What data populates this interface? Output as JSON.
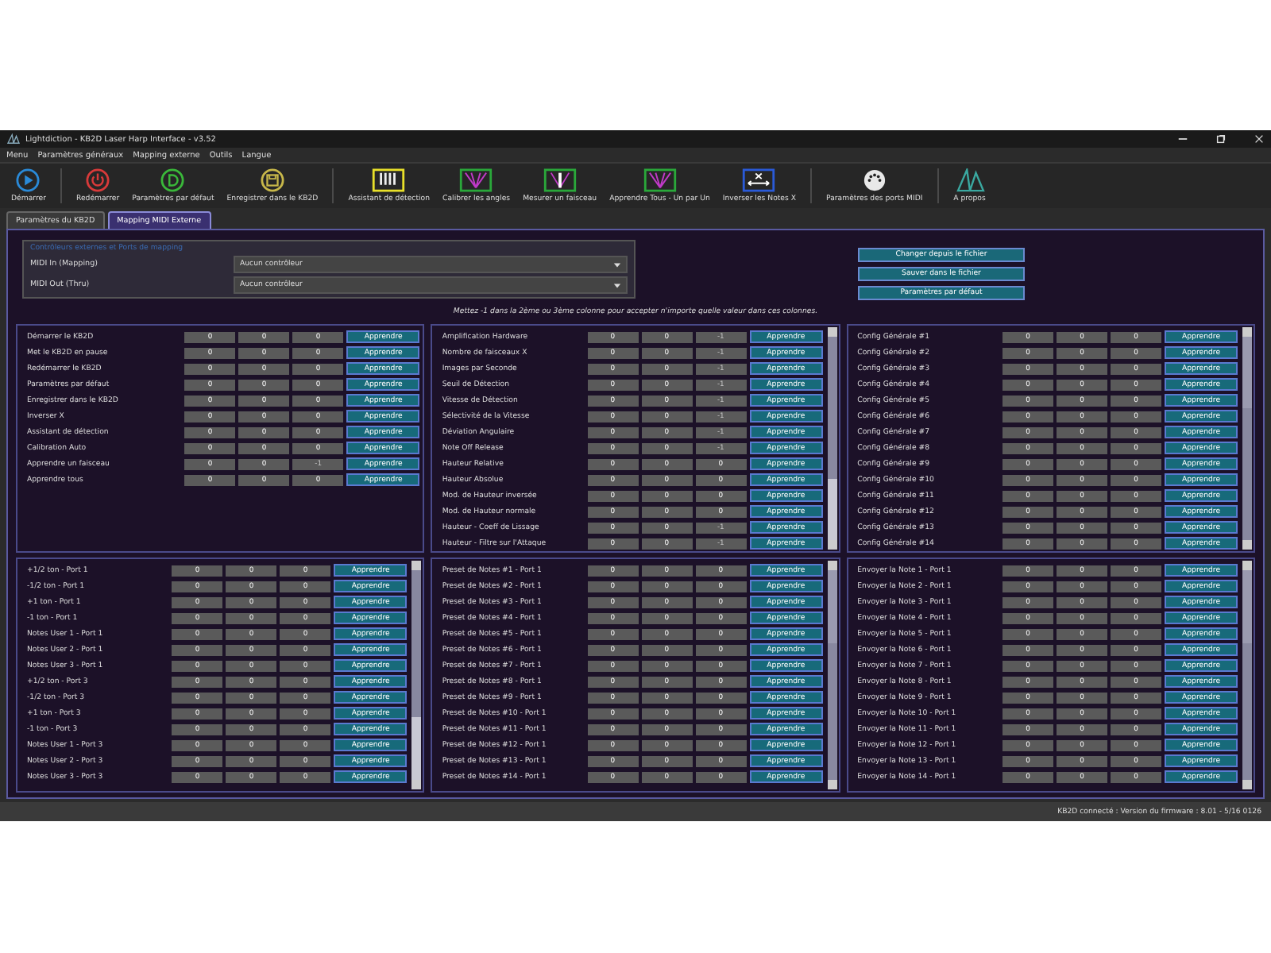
{
  "window": {
    "title": "Lightdiction - KB2D Laser Harp Interface - v3.52"
  },
  "menu": [
    "Menu",
    "Paramètres généraux",
    "Mapping externe",
    "Outils",
    "Langue"
  ],
  "toolbar": [
    {
      "label": "Démarrer",
      "kind": "play"
    },
    {
      "label": "Redémarrer",
      "kind": "power"
    },
    {
      "label": "Paramètres par défaut",
      "kind": "default"
    },
    {
      "label": "Enregistrer dans le KB2D",
      "kind": "save"
    },
    {
      "label": "Assistant de détection",
      "kind": "keys"
    },
    {
      "label": "Calibrer les angles",
      "kind": "fan"
    },
    {
      "label": "Mesurer un faisceau",
      "kind": "measure"
    },
    {
      "label": "Apprendre Tous - Un par Un",
      "kind": "fan"
    },
    {
      "label": "Inverser les Notes X",
      "kind": "swap"
    },
    {
      "label": "Paramètres des ports MIDI",
      "kind": "midi"
    },
    {
      "label": "A propos",
      "kind": "logo"
    }
  ],
  "tabs": [
    {
      "label": "Paramètres du KB2D",
      "selected": false
    },
    {
      "label": "Mapping MIDI Externe",
      "selected": true
    }
  ],
  "controllers": {
    "title": "Contrôleurs externes et Ports de mapping",
    "fields": [
      {
        "label": "MIDI In (Mapping)",
        "value": "Aucun contrôleur"
      },
      {
        "label": "MIDI Out (Thru)",
        "value": "Aucun contrôleur"
      }
    ]
  },
  "file_buttons": [
    "Changer depuis le fichier",
    "Sauver dans le fichier",
    "Paramètres par défaut"
  ],
  "hint": "Mettez -1 dans la 2ème ou 3ème colonne pour accepter n'importe quelle valeur dans ces colonnes.",
  "panels": [
    {
      "scrollbar": false,
      "rows": [
        {
          "label": "Démarrer le KB2D",
          "values": [
            "0",
            "0",
            "0"
          ],
          "last_disabled": false,
          "button": "Apprendre"
        },
        {
          "label": "Met le KB2D en pause",
          "values": [
            "0",
            "0",
            "0"
          ],
          "last_disabled": false,
          "button": "Apprendre"
        },
        {
          "label": "Redémarrer le KB2D",
          "values": [
            "0",
            "0",
            "0"
          ],
          "last_disabled": false,
          "button": "Apprendre"
        },
        {
          "label": "Paramètres par défaut",
          "values": [
            "0",
            "0",
            "0"
          ],
          "last_disabled": false,
          "button": "Apprendre"
        },
        {
          "label": "Enregistrer dans le KB2D",
          "values": [
            "0",
            "0",
            "0"
          ],
          "last_disabled": false,
          "button": "Apprendre"
        },
        {
          "label": "Inverser X",
          "values": [
            "0",
            "0",
            "0"
          ],
          "last_disabled": false,
          "button": "Apprendre"
        },
        {
          "label": "Assistant de détection",
          "values": [
            "0",
            "0",
            "0"
          ],
          "last_disabled": false,
          "button": "Apprendre"
        },
        {
          "label": "Calibration Auto",
          "values": [
            "0",
            "0",
            "0"
          ],
          "last_disabled": false,
          "button": "Apprendre"
        },
        {
          "label": "Apprendre un faisceau",
          "values": [
            "0",
            "0",
            "-1"
          ],
          "last_disabled": true,
          "button": "Apprendre"
        },
        {
          "label": "Apprendre tous",
          "values": [
            "0",
            "0",
            "0"
          ],
          "last_disabled": false,
          "button": "Apprendre"
        }
      ]
    },
    {
      "scrollbar": true,
      "scrolled_down": true,
      "rows": [
        {
          "label": "Amplification Hardware",
          "values": [
            "0",
            "0",
            "-1"
          ],
          "last_disabled": true,
          "button": "Apprendre"
        },
        {
          "label": "Nombre de faisceaux X",
          "values": [
            "0",
            "0",
            "-1"
          ],
          "last_disabled": true,
          "button": "Apprendre"
        },
        {
          "label": "Images par Seconde",
          "values": [
            "0",
            "0",
            "-1"
          ],
          "last_disabled": true,
          "button": "Apprendre"
        },
        {
          "label": "Seuil de Détection",
          "values": [
            "0",
            "0",
            "-1"
          ],
          "last_disabled": true,
          "button": "Apprendre"
        },
        {
          "label": "Vitesse de Détection",
          "values": [
            "0",
            "0",
            "-1"
          ],
          "last_disabled": true,
          "button": "Apprendre"
        },
        {
          "label": "Sélectivité de la Vitesse",
          "values": [
            "0",
            "0",
            "-1"
          ],
          "last_disabled": true,
          "button": "Apprendre"
        },
        {
          "label": "Déviation Angulaire",
          "values": [
            "0",
            "0",
            "-1"
          ],
          "last_disabled": true,
          "button": "Apprendre"
        },
        {
          "label": "Note Off Release",
          "values": [
            "0",
            "0",
            "-1"
          ],
          "last_disabled": true,
          "button": "Apprendre"
        },
        {
          "label": "Hauteur Relative",
          "values": [
            "0",
            "0",
            "0"
          ],
          "last_disabled": false,
          "button": "Apprendre"
        },
        {
          "label": "Hauteur Absolue",
          "values": [
            "0",
            "0",
            "0"
          ],
          "last_disabled": false,
          "button": "Apprendre"
        },
        {
          "label": "Mod. de Hauteur inversée",
          "values": [
            "0",
            "0",
            "0"
          ],
          "last_disabled": false,
          "button": "Apprendre"
        },
        {
          "label": "Mod. de Hauteur normale",
          "values": [
            "0",
            "0",
            "0"
          ],
          "last_disabled": false,
          "button": "Apprendre"
        },
        {
          "label": "Hauteur - Coeff de Lissage",
          "values": [
            "0",
            "0",
            "-1"
          ],
          "last_disabled": true,
          "button": "Apprendre"
        },
        {
          "label": "Hauteur - Filtre sur l'Attaque",
          "values": [
            "0",
            "0",
            "-1"
          ],
          "last_disabled": true,
          "button": "Apprendre"
        }
      ]
    },
    {
      "scrollbar": true,
      "scrolled_down": false,
      "rows": [
        {
          "label": "Config Générale #1",
          "values": [
            "0",
            "0",
            "0"
          ],
          "last_disabled": false,
          "button": "Apprendre"
        },
        {
          "label": "Config Générale #2",
          "values": [
            "0",
            "0",
            "0"
          ],
          "last_disabled": false,
          "button": "Apprendre"
        },
        {
          "label": "Config Générale #3",
          "values": [
            "0",
            "0",
            "0"
          ],
          "last_disabled": false,
          "button": "Apprendre"
        },
        {
          "label": "Config Générale #4",
          "values": [
            "0",
            "0",
            "0"
          ],
          "last_disabled": false,
          "button": "Apprendre"
        },
        {
          "label": "Config Générale #5",
          "values": [
            "0",
            "0",
            "0"
          ],
          "last_disabled": false,
          "button": "Apprendre"
        },
        {
          "label": "Config Générale #6",
          "values": [
            "0",
            "0",
            "0"
          ],
          "last_disabled": false,
          "button": "Apprendre"
        },
        {
          "label": "Config Générale #7",
          "values": [
            "0",
            "0",
            "0"
          ],
          "last_disabled": false,
          "button": "Apprendre"
        },
        {
          "label": "Config Générale #8",
          "values": [
            "0",
            "0",
            "0"
          ],
          "last_disabled": false,
          "button": "Apprendre"
        },
        {
          "label": "Config Générale #9",
          "values": [
            "0",
            "0",
            "0"
          ],
          "last_disabled": false,
          "button": "Apprendre"
        },
        {
          "label": "Config Générale #10",
          "values": [
            "0",
            "0",
            "0"
          ],
          "last_disabled": false,
          "button": "Apprendre"
        },
        {
          "label": "Config Générale #11",
          "values": [
            "0",
            "0",
            "0"
          ],
          "last_disabled": false,
          "button": "Apprendre"
        },
        {
          "label": "Config Générale #12",
          "values": [
            "0",
            "0",
            "0"
          ],
          "last_disabled": false,
          "button": "Apprendre"
        },
        {
          "label": "Config Générale #13",
          "values": [
            "0",
            "0",
            "0"
          ],
          "last_disabled": false,
          "button": "Apprendre"
        },
        {
          "label": "Config Générale #14",
          "values": [
            "0",
            "0",
            "0"
          ],
          "last_disabled": false,
          "button": "Apprendre"
        }
      ]
    },
    {
      "scrollbar": true,
      "scrolled_down": true,
      "rows": [
        {
          "label": "+1/2 ton - Port 1",
          "values": [
            "0",
            "0",
            "0"
          ],
          "last_disabled": false,
          "button": "Apprendre"
        },
        {
          "label": "-1/2 ton - Port 1",
          "values": [
            "0",
            "0",
            "0"
          ],
          "last_disabled": false,
          "button": "Apprendre"
        },
        {
          "label": "+1 ton - Port 1",
          "values": [
            "0",
            "0",
            "0"
          ],
          "last_disabled": false,
          "button": "Apprendre"
        },
        {
          "label": "-1 ton - Port 1",
          "values": [
            "0",
            "0",
            "0"
          ],
          "last_disabled": false,
          "button": "Apprendre"
        },
        {
          "label": "Notes User 1 - Port 1",
          "values": [
            "0",
            "0",
            "0"
          ],
          "last_disabled": false,
          "button": "Apprendre"
        },
        {
          "label": "Notes User 2 - Port 1",
          "values": [
            "0",
            "0",
            "0"
          ],
          "last_disabled": false,
          "button": "Apprendre"
        },
        {
          "label": "Notes User 3 - Port 1",
          "values": [
            "0",
            "0",
            "0"
          ],
          "last_disabled": false,
          "button": "Apprendre"
        },
        {
          "label": "+1/2 ton - Port 3",
          "values": [
            "0",
            "0",
            "0"
          ],
          "last_disabled": false,
          "button": "Apprendre"
        },
        {
          "label": "-1/2 ton - Port 3",
          "values": [
            "0",
            "0",
            "0"
          ],
          "last_disabled": false,
          "button": "Apprendre"
        },
        {
          "label": "+1 ton - Port 3",
          "values": [
            "0",
            "0",
            "0"
          ],
          "last_disabled": false,
          "button": "Apprendre"
        },
        {
          "label": "-1 ton - Port 3",
          "values": [
            "0",
            "0",
            "0"
          ],
          "last_disabled": false,
          "button": "Apprendre"
        },
        {
          "label": "Notes User 1 - Port 3",
          "values": [
            "0",
            "0",
            "0"
          ],
          "last_disabled": false,
          "button": "Apprendre"
        },
        {
          "label": "Notes User 2 - Port 3",
          "values": [
            "0",
            "0",
            "0"
          ],
          "last_disabled": false,
          "button": "Apprendre"
        },
        {
          "label": "Notes User 3 - Port 3",
          "values": [
            "0",
            "0",
            "0"
          ],
          "last_disabled": false,
          "button": "Apprendre"
        }
      ]
    },
    {
      "scrollbar": true,
      "scrolled_down": false,
      "rows": [
        {
          "label": "Preset de Notes #1 - Port 1",
          "values": [
            "0",
            "0",
            "0"
          ],
          "last_disabled": false,
          "button": "Apprendre"
        },
        {
          "label": "Preset de Notes #2 - Port 1",
          "values": [
            "0",
            "0",
            "0"
          ],
          "last_disabled": false,
          "button": "Apprendre"
        },
        {
          "label": "Preset de Notes #3 - Port 1",
          "values": [
            "0",
            "0",
            "0"
          ],
          "last_disabled": false,
          "button": "Apprendre"
        },
        {
          "label": "Preset de Notes #4 - Port 1",
          "values": [
            "0",
            "0",
            "0"
          ],
          "last_disabled": false,
          "button": "Apprendre"
        },
        {
          "label": "Preset de Notes #5 - Port 1",
          "values": [
            "0",
            "0",
            "0"
          ],
          "last_disabled": false,
          "button": "Apprendre"
        },
        {
          "label": "Preset de Notes #6 - Port 1",
          "values": [
            "0",
            "0",
            "0"
          ],
          "last_disabled": false,
          "button": "Apprendre"
        },
        {
          "label": "Preset de Notes #7 - Port 1",
          "values": [
            "0",
            "0",
            "0"
          ],
          "last_disabled": false,
          "button": "Apprendre"
        },
        {
          "label": "Preset de Notes #8 - Port 1",
          "values": [
            "0",
            "0",
            "0"
          ],
          "last_disabled": false,
          "button": "Apprendre"
        },
        {
          "label": "Preset de Notes #9 - Port 1",
          "values": [
            "0",
            "0",
            "0"
          ],
          "last_disabled": false,
          "button": "Apprendre"
        },
        {
          "label": "Preset de Notes #10 - Port 1",
          "values": [
            "0",
            "0",
            "0"
          ],
          "last_disabled": false,
          "button": "Apprendre"
        },
        {
          "label": "Preset de Notes #11 - Port 1",
          "values": [
            "0",
            "0",
            "0"
          ],
          "last_disabled": false,
          "button": "Apprendre"
        },
        {
          "label": "Preset de Notes #12 - Port 1",
          "values": [
            "0",
            "0",
            "0"
          ],
          "last_disabled": false,
          "button": "Apprendre"
        },
        {
          "label": "Preset de Notes #13 - Port 1",
          "values": [
            "0",
            "0",
            "0"
          ],
          "last_disabled": false,
          "button": "Apprendre"
        },
        {
          "label": "Preset de Notes #14 - Port 1",
          "values": [
            "0",
            "0",
            "0"
          ],
          "last_disabled": false,
          "button": "Apprendre"
        }
      ]
    },
    {
      "scrollbar": true,
      "scrolled_down": false,
      "rows": [
        {
          "label": "Envoyer la Note 1 - Port 1",
          "values": [
            "0",
            "0",
            "0"
          ],
          "last_disabled": false,
          "button": "Apprendre"
        },
        {
          "label": "Envoyer la Note 2 - Port 1",
          "values": [
            "0",
            "0",
            "0"
          ],
          "last_disabled": false,
          "button": "Apprendre"
        },
        {
          "label": "Envoyer la Note 3 - Port 1",
          "values": [
            "0",
            "0",
            "0"
          ],
          "last_disabled": false,
          "button": "Apprendre"
        },
        {
          "label": "Envoyer la Note 4 - Port 1",
          "values": [
            "0",
            "0",
            "0"
          ],
          "last_disabled": false,
          "button": "Apprendre"
        },
        {
          "label": "Envoyer la Note 5 - Port 1",
          "values": [
            "0",
            "0",
            "0"
          ],
          "last_disabled": false,
          "button": "Apprendre"
        },
        {
          "label": "Envoyer la Note 6 - Port 1",
          "values": [
            "0",
            "0",
            "0"
          ],
          "last_disabled": false,
          "button": "Apprendre"
        },
        {
          "label": "Envoyer la Note 7 - Port 1",
          "values": [
            "0",
            "0",
            "0"
          ],
          "last_disabled": false,
          "button": "Apprendre"
        },
        {
          "label": "Envoyer la Note 8 - Port 1",
          "values": [
            "0",
            "0",
            "0"
          ],
          "last_disabled": false,
          "button": "Apprendre"
        },
        {
          "label": "Envoyer la Note 9 - Port 1",
          "values": [
            "0",
            "0",
            "0"
          ],
          "last_disabled": false,
          "button": "Apprendre"
        },
        {
          "label": "Envoyer la Note 10 - Port 1",
          "values": [
            "0",
            "0",
            "0"
          ],
          "last_disabled": false,
          "button": "Apprendre"
        },
        {
          "label": "Envoyer la Note 11 - Port 1",
          "values": [
            "0",
            "0",
            "0"
          ],
          "last_disabled": false,
          "button": "Apprendre"
        },
        {
          "label": "Envoyer la Note 12 - Port 1",
          "values": [
            "0",
            "0",
            "0"
          ],
          "last_disabled": false,
          "button": "Apprendre"
        },
        {
          "label": "Envoyer la Note 13 - Port 1",
          "values": [
            "0",
            "0",
            "0"
          ],
          "last_disabled": false,
          "button": "Apprendre"
        },
        {
          "label": "Envoyer la Note 14 - Port 1",
          "values": [
            "0",
            "0",
            "0"
          ],
          "last_disabled": false,
          "button": "Apprendre"
        }
      ]
    }
  ],
  "status_bar": "KB2D connecté : Version du firmware : 8.01 - 5/16 0126"
}
